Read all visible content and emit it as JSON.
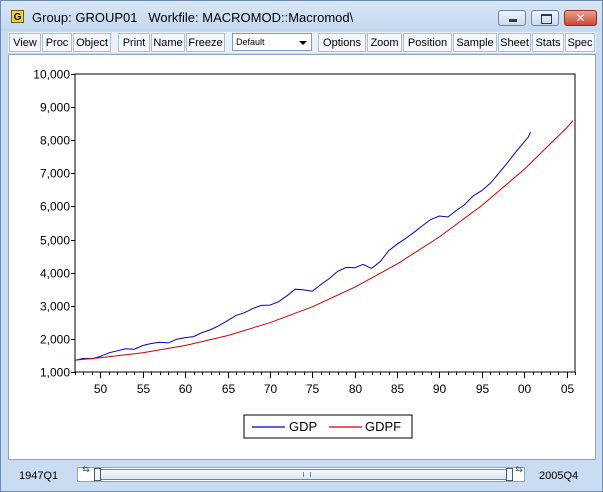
{
  "window": {
    "icon_letter": "G",
    "title": "Group: GROUP01   Workfile: MACROMOD::Macromod\\",
    "close_glyph": "✕"
  },
  "toolbar": {
    "buttons": [
      "View",
      "Proc",
      "Object",
      "Print",
      "Name",
      "Freeze",
      "Options",
      "Zoom",
      "Position",
      "Sample",
      "Sheet",
      "Stats",
      "Spec"
    ],
    "select_value": "Default"
  },
  "chart_data": {
    "type": "line",
    "x_start": 1947.0,
    "x_end": 2005.75,
    "xlim": [
      1947,
      2006
    ],
    "ylim": [
      1000,
      10000
    ],
    "x_ticks": [
      1950,
      1955,
      1960,
      1965,
      1970,
      1975,
      1980,
      1985,
      1990,
      1995,
      2000,
      2005
    ],
    "x_tick_labels": [
      "50",
      "55",
      "60",
      "65",
      "70",
      "75",
      "80",
      "85",
      "90",
      "95",
      "00",
      "05"
    ],
    "y_ticks": [
      1000,
      2000,
      3000,
      4000,
      5000,
      6000,
      7000,
      8000,
      9000,
      10000
    ],
    "y_tick_labels": [
      "1,000",
      "2,000",
      "3,000",
      "4,000",
      "5,000",
      "6,000",
      "7,000",
      "8,000",
      "9,000",
      "10,000"
    ],
    "legend_position": "bottom-center",
    "series": [
      {
        "name": "GDP",
        "color": "#0000c8",
        "points": [
          [
            1947,
            1350
          ],
          [
            1948,
            1410
          ],
          [
            1949,
            1400
          ],
          [
            1950,
            1470
          ],
          [
            1951,
            1580
          ],
          [
            1952,
            1640
          ],
          [
            1953,
            1700
          ],
          [
            1954,
            1690
          ],
          [
            1955,
            1800
          ],
          [
            1956,
            1860
          ],
          [
            1957,
            1900
          ],
          [
            1958,
            1880
          ],
          [
            1959,
            1990
          ],
          [
            1960,
            2040
          ],
          [
            1961,
            2070
          ],
          [
            1962,
            2190
          ],
          [
            1963,
            2280
          ],
          [
            1964,
            2400
          ],
          [
            1965,
            2550
          ],
          [
            1966,
            2710
          ],
          [
            1967,
            2790
          ],
          [
            1968,
            2920
          ],
          [
            1969,
            3010
          ],
          [
            1970,
            3020
          ],
          [
            1971,
            3120
          ],
          [
            1972,
            3300
          ],
          [
            1973,
            3500
          ],
          [
            1974,
            3480
          ],
          [
            1975,
            3440
          ],
          [
            1976,
            3640
          ],
          [
            1977,
            3820
          ],
          [
            1978,
            4040
          ],
          [
            1979,
            4160
          ],
          [
            1980,
            4150
          ],
          [
            1981,
            4250
          ],
          [
            1982,
            4130
          ],
          [
            1983,
            4330
          ],
          [
            1984,
            4660
          ],
          [
            1985,
            4860
          ],
          [
            1986,
            5030
          ],
          [
            1987,
            5220
          ],
          [
            1988,
            5420
          ],
          [
            1989,
            5610
          ],
          [
            1990,
            5710
          ],
          [
            1991,
            5680
          ],
          [
            1992,
            5880
          ],
          [
            1993,
            6060
          ],
          [
            1994,
            6320
          ],
          [
            1995,
            6480
          ],
          [
            1996,
            6700
          ],
          [
            1997,
            7000
          ],
          [
            1998,
            7310
          ],
          [
            1999,
            7640
          ],
          [
            2000,
            7950
          ],
          [
            2000.5,
            8100
          ],
          [
            2000.75,
            8250
          ]
        ]
      },
      {
        "name": "GDPF",
        "color": "#d00000",
        "points": [
          [
            1947,
            1360
          ],
          [
            1950,
            1430
          ],
          [
            1955,
            1580
          ],
          [
            1960,
            1800
          ],
          [
            1965,
            2100
          ],
          [
            1970,
            2490
          ],
          [
            1975,
            2970
          ],
          [
            1980,
            3560
          ],
          [
            1985,
            4260
          ],
          [
            1990,
            5080
          ],
          [
            1995,
            6030
          ],
          [
            2000,
            7120
          ],
          [
            2005,
            8370
          ],
          [
            2005.75,
            8590
          ]
        ]
      }
    ]
  },
  "status": {
    "start": "1947Q1",
    "end": "2005Q4",
    "grip": "|||",
    "left_arrows": "⇆",
    "right_arrows": "⇆"
  }
}
